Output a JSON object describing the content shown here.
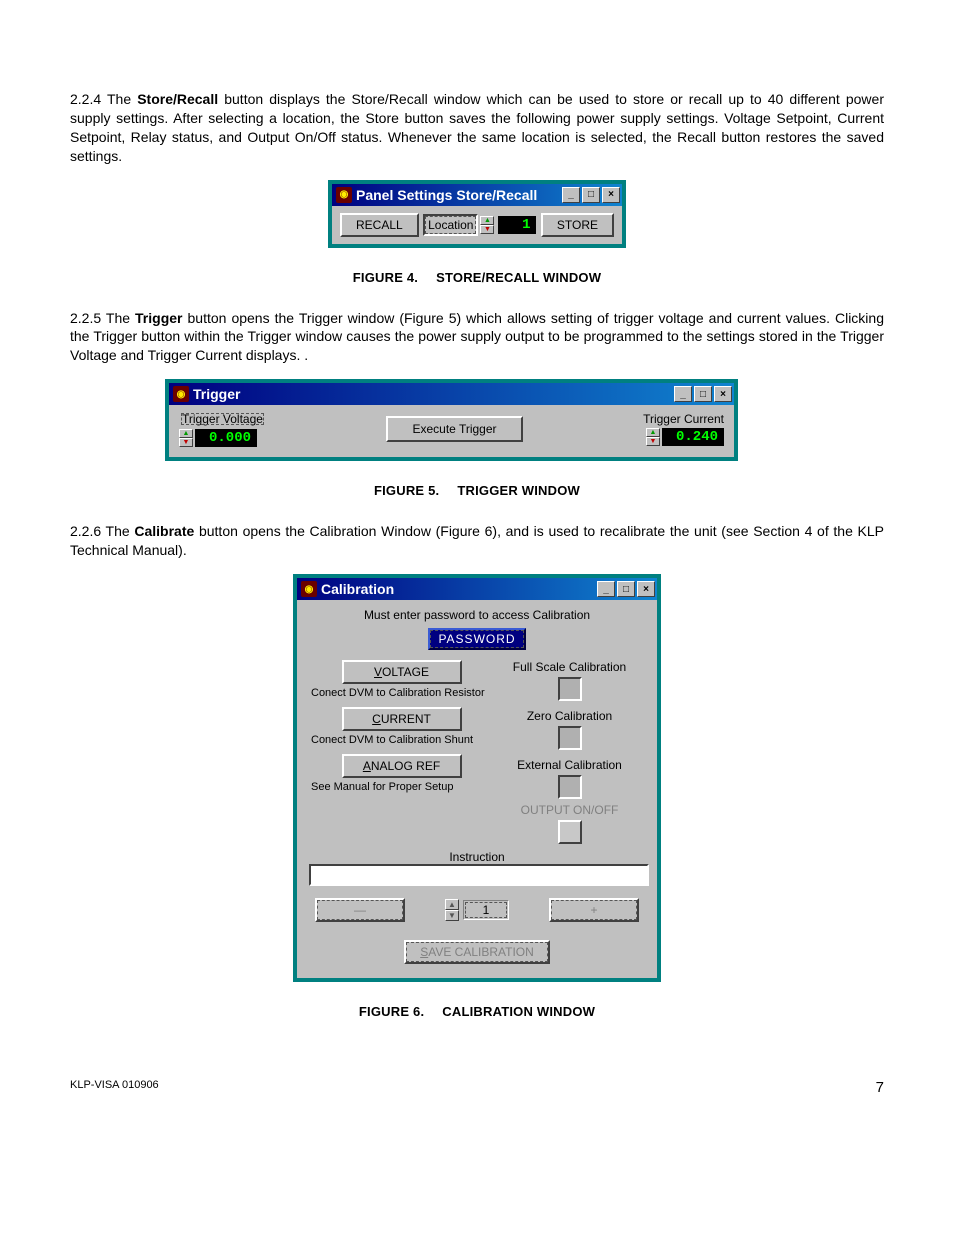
{
  "paragraphs": {
    "p224_pre": "2.2.4   The ",
    "p224_bold": "Store/Recall",
    "p224_post": " button displays the Store/Recall window which can be used to store or recall up to 40 different power supply settings. After selecting a location, the Store button saves the following power supply settings. Voltage Setpoint, Current Setpoint, Relay status, and Output On/Off status. Whenever the same location is selected, the Recall button restores the saved settings.",
    "p225_pre": "2.2.5   The ",
    "p225_bold": "Trigger",
    "p225_post": " button opens the Trigger window (Figure 5) which allows setting of trigger voltage and current values. Clicking the Trigger button within the Trigger window causes the power supply output to be programmed to the settings stored in the Trigger Voltage and Trigger Current displays. .",
    "p226_pre": "2.2.6   The ",
    "p226_bold": "Calibrate",
    "p226_post": " button opens the Calibration Window (Figure 6), and is used to recalibrate the unit (see Section 4 of the KLP Technical Manual)."
  },
  "figures": {
    "f4num": "FIGURE 4.",
    "f4cap": "STORE/RECALL WINDOW",
    "f5num": "FIGURE 5.",
    "f5cap": "TRIGGER WINDOW",
    "f6num": "FIGURE 6.",
    "f6cap": "CALIBRATION WINDOW"
  },
  "store_recall": {
    "title": "Panel Settings Store/Recall",
    "recall": "RECALL",
    "location_label": "Location",
    "location_value": "1",
    "store": "STORE"
  },
  "trigger": {
    "title": "Trigger",
    "voltage_label": "Trigger Voltage",
    "voltage_value": "0.000",
    "execute": "Execute Trigger",
    "current_label": "Trigger Current",
    "current_value": "0.240"
  },
  "calibration": {
    "title": "Calibration",
    "prompt": "Must enter password to access Calibration",
    "password": "PASSWORD",
    "voltage_btn_key": "V",
    "voltage_btn_rest": "OLTAGE",
    "voltage_hint": "Conect DVM to Calibration Resistor",
    "current_btn_key": "C",
    "current_btn_rest": "URRENT",
    "current_hint": "Conect DVM to Calibration Shunt",
    "analog_btn_key": "A",
    "analog_btn_rest": "NALOG REF",
    "analog_hint": "See Manual for Proper Setup",
    "full_scale": "Full Scale Calibration",
    "zero": "Zero Calibration",
    "external": "External Calibration",
    "output": "OUTPUT ON/OFF",
    "instruction": "Instruction",
    "step_value": "1",
    "minus": "—",
    "plus": "+",
    "save_key": "S",
    "save_rest": "AVE CALIBRATION"
  },
  "footer_left": "KLP-VISA 010906",
  "footer_right": "7"
}
